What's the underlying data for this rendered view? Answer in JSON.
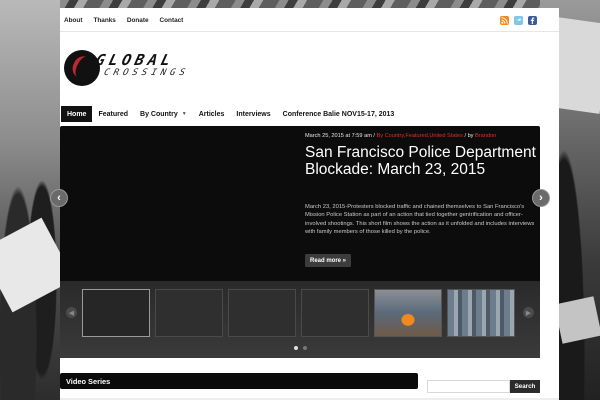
{
  "topbar": {
    "links": [
      "About",
      "Thanks",
      "Donate",
      "Contact"
    ],
    "social": {
      "rss": "rss-icon",
      "twitter": "twitter-icon",
      "facebook": "facebook-icon"
    }
  },
  "logo": {
    "line1": "GLOBAL",
    "line2": "CROSSINGS"
  },
  "nav": {
    "items": [
      {
        "label": "Home",
        "active": true
      },
      {
        "label": "Featured"
      },
      {
        "label": "By Country",
        "dropdown": true
      },
      {
        "label": "Articles"
      },
      {
        "label": "Interviews"
      },
      {
        "label": "Conference Balie NOV15-17, 2013"
      }
    ]
  },
  "slider": {
    "date": "March 25, 2015 at 7:59 am",
    "sep1": " / ",
    "cat1": "By Country",
    "cat2": "Featured",
    "cat3": "United States",
    "sep2": " / by ",
    "author": "Brandon",
    "title": "San Francisco Police Department Blockade: March 23, 2015",
    "description": "March 23, 2015-Protesters blocked traffic and chained themselves to San Francisco's Mission Police Station as part of an action that tied together gentrification and officer-involved shootings. This short film shows the action as it unfolded and includes interviews with family members of those killed by the police.",
    "read_more": "Read more »",
    "prev_glyph": "‹",
    "next_glyph": "›",
    "dots": 2,
    "active_dot": 0
  },
  "bottom": {
    "video_series": "Video Series",
    "search_placeholder": "",
    "search_button": "Search"
  },
  "colors": {
    "accent": "#d9342b",
    "dark": "#0c0c0c"
  }
}
